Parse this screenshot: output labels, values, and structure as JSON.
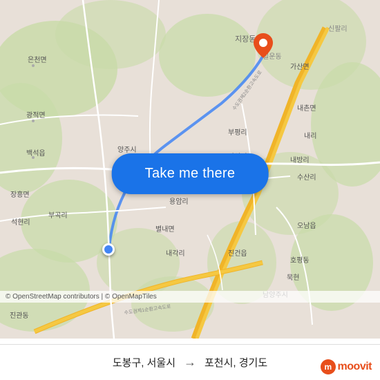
{
  "map": {
    "background_color": "#e8e0d8",
    "roads_color": "#ffffff",
    "highway_color": "#f5c842",
    "minor_road_color": "#ffffff",
    "green_area_color": "#c8dba8",
    "water_color": "#aad3df"
  },
  "button": {
    "label": "Take me there",
    "bg_color": "#1a73e8",
    "text_color": "#ffffff"
  },
  "attribution": {
    "text": "© OpenStreetMap contributors | © OpenMapTiles"
  },
  "route": {
    "origin": "도봉구, 서울시",
    "destination": "포천시, 경기도",
    "arrow": "→"
  },
  "branding": {
    "name": "moovit",
    "icon_letter": "m"
  }
}
